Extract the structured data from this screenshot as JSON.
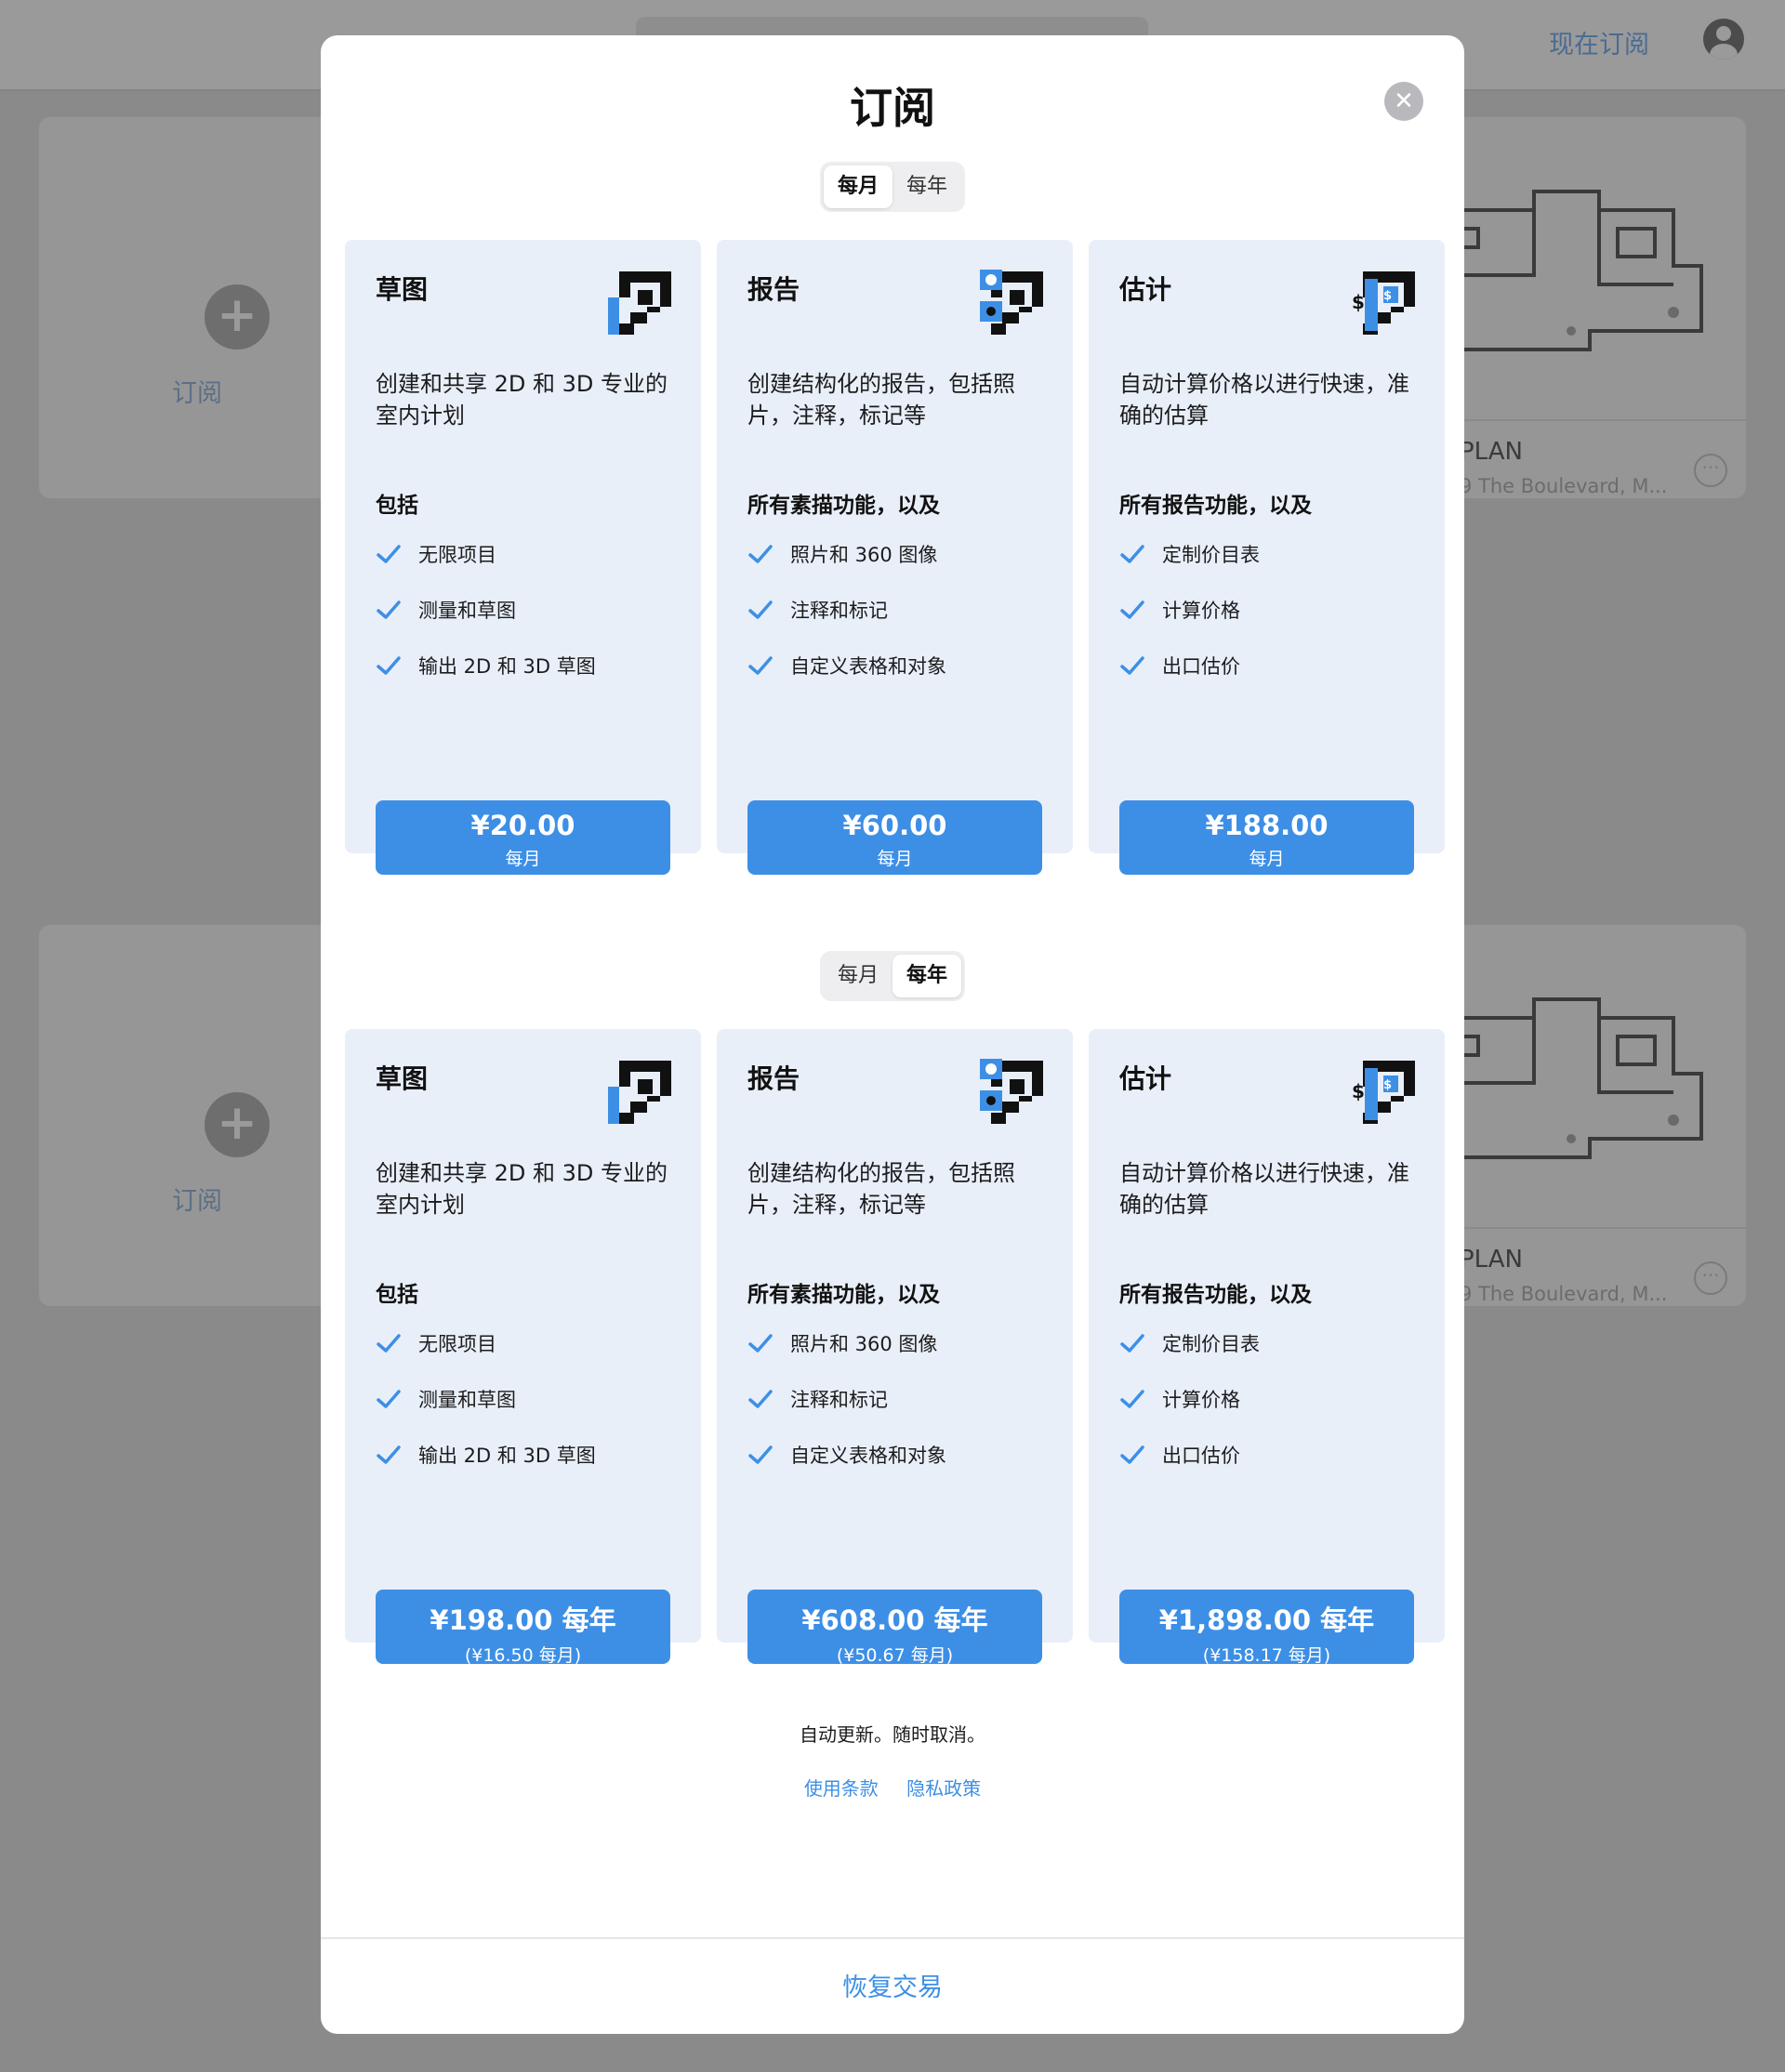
{
  "background": {
    "tabs": [
      "",
      ""
    ],
    "subscribe_now": "现在订阅",
    "add_label": "订阅",
    "plan_title": "PLAN",
    "plan_address": "9 The Boulevard, M...",
    "more": "···"
  },
  "modal": {
    "title": "订阅",
    "close": "✕",
    "monthly_label": "每月",
    "yearly_label": "每年",
    "monthly_plans": [
      {
        "name": "草图",
        "description": "创建和共享 2D 和 3D 专业的室内计划",
        "includes": "包括",
        "features": [
          "无限项目",
          "测量和草图",
          "输出 2D 和 3D 草图"
        ],
        "price": "¥20.00",
        "period": "每月"
      },
      {
        "name": "报告",
        "description": "创建结构化的报告，包括照片，注释，标记等",
        "includes": "所有素描功能，以及",
        "features": [
          "照片和 360 图像",
          "注释和标记",
          "自定义表格和对象"
        ],
        "price": "¥60.00",
        "period": "每月"
      },
      {
        "name": "估计",
        "description": "自动计算价格以进行快速，准确的估算",
        "includes": "所有报告功能，以及",
        "features": [
          "定制价目表",
          "计算价格",
          "出口估价"
        ],
        "price": "¥188.00",
        "period": "每月"
      }
    ],
    "yearly_plans": [
      {
        "name": "草图",
        "description": "创建和共享 2D 和 3D 专业的室内计划",
        "includes": "包括",
        "features": [
          "无限项目",
          "测量和草图",
          "输出 2D 和 3D 草图"
        ],
        "price": "¥198.00 每年",
        "period": "(¥16.50 每月)"
      },
      {
        "name": "报告",
        "description": "创建结构化的报告，包括照片，注释，标记等",
        "includes": "所有素描功能，以及",
        "features": [
          "照片和 360 图像",
          "注释和标记",
          "自定义表格和对象"
        ],
        "price": "¥608.00 每年",
        "period": "(¥50.67 每月)"
      },
      {
        "name": "估计",
        "description": "自动计算价格以进行快速，准确的估算",
        "includes": "所有报告功能，以及",
        "features": [
          "定制价目表",
          "计算价格",
          "出口估价"
        ],
        "price": "¥1,898.00 每年",
        "period": "(¥158.17 每月)"
      }
    ],
    "auto_renew": "自动更新。随时取消。",
    "terms": "使用条款",
    "privacy": "隐私政策",
    "restore": "恢复交易"
  },
  "colors": {
    "accent": "#3d8fe6",
    "card_bg": "#e9eff8",
    "icon_blue": "#3d8fe6",
    "icon_dark": "#111111"
  },
  "icons": {
    "check": "check-icon",
    "sketch": "floorplan-icon",
    "report": "report-icon",
    "estimate": "estimate-icon"
  }
}
